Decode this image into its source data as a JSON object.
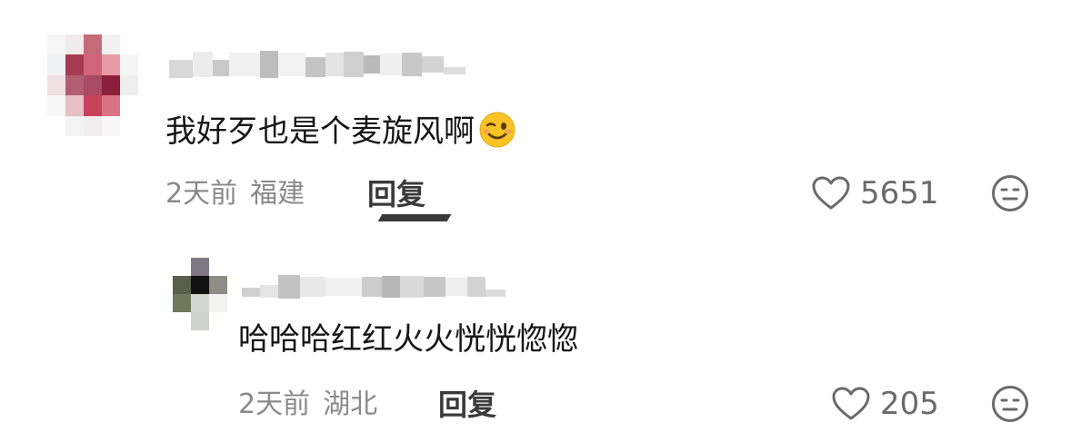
{
  "comments": [
    {
      "text": "我好歹也是个麦旋风啊",
      "emoji": "wink-icon",
      "time": "2天前",
      "location": "福建",
      "reply_label": "回复",
      "likes": "5651"
    },
    {
      "text": "哈哈哈红红火火恍恍惚惚",
      "time": "2天前",
      "location": "湖北",
      "reply_label": "回复",
      "likes": "205"
    }
  ],
  "colors": {
    "text": "#161616",
    "meta": "#8a8a8a",
    "reply": "#3a3a3a",
    "icon": "#6a6a6a",
    "emoji_face": "#f7c325"
  }
}
